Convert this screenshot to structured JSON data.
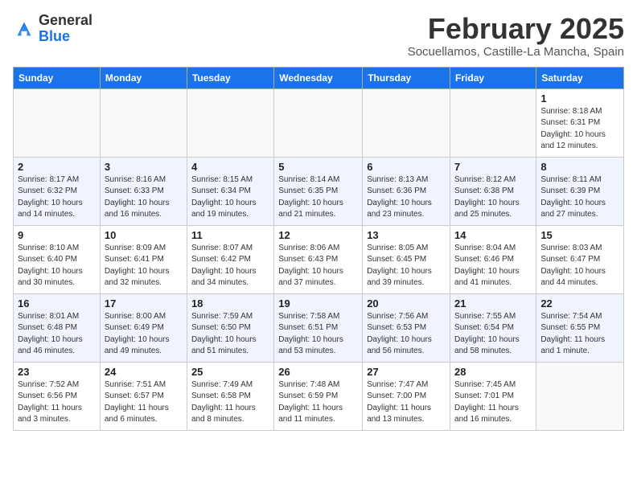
{
  "logo": {
    "general": "General",
    "blue": "Blue"
  },
  "header": {
    "month": "February 2025",
    "location": "Socuellamos, Castille-La Mancha, Spain"
  },
  "weekdays": [
    "Sunday",
    "Monday",
    "Tuesday",
    "Wednesday",
    "Thursday",
    "Friday",
    "Saturday"
  ],
  "weeks": [
    [
      {
        "day": "",
        "info": ""
      },
      {
        "day": "",
        "info": ""
      },
      {
        "day": "",
        "info": ""
      },
      {
        "day": "",
        "info": ""
      },
      {
        "day": "",
        "info": ""
      },
      {
        "day": "",
        "info": ""
      },
      {
        "day": "1",
        "info": "Sunrise: 8:18 AM\nSunset: 6:31 PM\nDaylight: 10 hours\nand 12 minutes."
      }
    ],
    [
      {
        "day": "2",
        "info": "Sunrise: 8:17 AM\nSunset: 6:32 PM\nDaylight: 10 hours\nand 14 minutes."
      },
      {
        "day": "3",
        "info": "Sunrise: 8:16 AM\nSunset: 6:33 PM\nDaylight: 10 hours\nand 16 minutes."
      },
      {
        "day": "4",
        "info": "Sunrise: 8:15 AM\nSunset: 6:34 PM\nDaylight: 10 hours\nand 19 minutes."
      },
      {
        "day": "5",
        "info": "Sunrise: 8:14 AM\nSunset: 6:35 PM\nDaylight: 10 hours\nand 21 minutes."
      },
      {
        "day": "6",
        "info": "Sunrise: 8:13 AM\nSunset: 6:36 PM\nDaylight: 10 hours\nand 23 minutes."
      },
      {
        "day": "7",
        "info": "Sunrise: 8:12 AM\nSunset: 6:38 PM\nDaylight: 10 hours\nand 25 minutes."
      },
      {
        "day": "8",
        "info": "Sunrise: 8:11 AM\nSunset: 6:39 PM\nDaylight: 10 hours\nand 27 minutes."
      }
    ],
    [
      {
        "day": "9",
        "info": "Sunrise: 8:10 AM\nSunset: 6:40 PM\nDaylight: 10 hours\nand 30 minutes."
      },
      {
        "day": "10",
        "info": "Sunrise: 8:09 AM\nSunset: 6:41 PM\nDaylight: 10 hours\nand 32 minutes."
      },
      {
        "day": "11",
        "info": "Sunrise: 8:07 AM\nSunset: 6:42 PM\nDaylight: 10 hours\nand 34 minutes."
      },
      {
        "day": "12",
        "info": "Sunrise: 8:06 AM\nSunset: 6:43 PM\nDaylight: 10 hours\nand 37 minutes."
      },
      {
        "day": "13",
        "info": "Sunrise: 8:05 AM\nSunset: 6:45 PM\nDaylight: 10 hours\nand 39 minutes."
      },
      {
        "day": "14",
        "info": "Sunrise: 8:04 AM\nSunset: 6:46 PM\nDaylight: 10 hours\nand 41 minutes."
      },
      {
        "day": "15",
        "info": "Sunrise: 8:03 AM\nSunset: 6:47 PM\nDaylight: 10 hours\nand 44 minutes."
      }
    ],
    [
      {
        "day": "16",
        "info": "Sunrise: 8:01 AM\nSunset: 6:48 PM\nDaylight: 10 hours\nand 46 minutes."
      },
      {
        "day": "17",
        "info": "Sunrise: 8:00 AM\nSunset: 6:49 PM\nDaylight: 10 hours\nand 49 minutes."
      },
      {
        "day": "18",
        "info": "Sunrise: 7:59 AM\nSunset: 6:50 PM\nDaylight: 10 hours\nand 51 minutes."
      },
      {
        "day": "19",
        "info": "Sunrise: 7:58 AM\nSunset: 6:51 PM\nDaylight: 10 hours\nand 53 minutes."
      },
      {
        "day": "20",
        "info": "Sunrise: 7:56 AM\nSunset: 6:53 PM\nDaylight: 10 hours\nand 56 minutes."
      },
      {
        "day": "21",
        "info": "Sunrise: 7:55 AM\nSunset: 6:54 PM\nDaylight: 10 hours\nand 58 minutes."
      },
      {
        "day": "22",
        "info": "Sunrise: 7:54 AM\nSunset: 6:55 PM\nDaylight: 11 hours\nand 1 minute."
      }
    ],
    [
      {
        "day": "23",
        "info": "Sunrise: 7:52 AM\nSunset: 6:56 PM\nDaylight: 11 hours\nand 3 minutes."
      },
      {
        "day": "24",
        "info": "Sunrise: 7:51 AM\nSunset: 6:57 PM\nDaylight: 11 hours\nand 6 minutes."
      },
      {
        "day": "25",
        "info": "Sunrise: 7:49 AM\nSunset: 6:58 PM\nDaylight: 11 hours\nand 8 minutes."
      },
      {
        "day": "26",
        "info": "Sunrise: 7:48 AM\nSunset: 6:59 PM\nDaylight: 11 hours\nand 11 minutes."
      },
      {
        "day": "27",
        "info": "Sunrise: 7:47 AM\nSunset: 7:00 PM\nDaylight: 11 hours\nand 13 minutes."
      },
      {
        "day": "28",
        "info": "Sunrise: 7:45 AM\nSunset: 7:01 PM\nDaylight: 11 hours\nand 16 minutes."
      },
      {
        "day": "",
        "info": ""
      }
    ]
  ]
}
